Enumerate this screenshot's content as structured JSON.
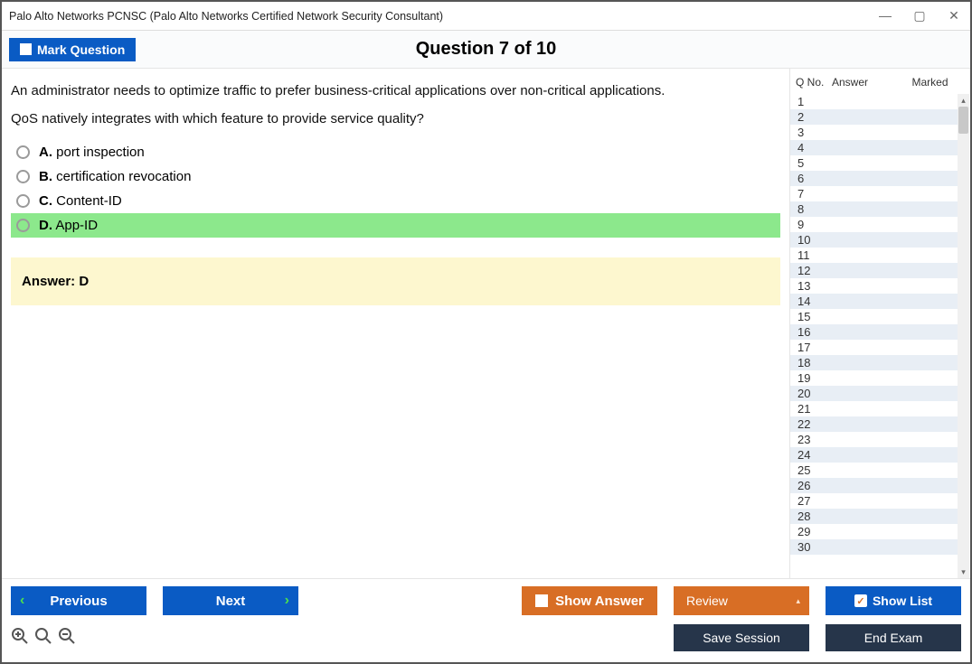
{
  "window_title": "Palo Alto Networks PCNSC (Palo Alto Networks Certified Network Security Consultant)",
  "top": {
    "mark_label": "Mark Question",
    "counter": "Question 7 of 10"
  },
  "question": {
    "line1": "An administrator needs to optimize traffic to prefer business-critical applications over non-critical applications.",
    "line2": "QoS natively integrates with which feature to provide service quality?"
  },
  "options": {
    "A": {
      "letter": "A.",
      "text": "port inspection",
      "correct": false
    },
    "B": {
      "letter": "B.",
      "text": "certification revocation",
      "correct": false
    },
    "C": {
      "letter": "C.",
      "text": "Content-ID",
      "correct": false
    },
    "D": {
      "letter": "D.",
      "text": "App-ID",
      "correct": true
    }
  },
  "answer_box": "Answer: D",
  "sidebar": {
    "headers": {
      "qno": "Q No.",
      "answer": "Answer",
      "marked": "Marked"
    },
    "rows": [
      "1",
      "2",
      "3",
      "4",
      "5",
      "6",
      "7",
      "8",
      "9",
      "10",
      "11",
      "12",
      "13",
      "14",
      "15",
      "16",
      "17",
      "18",
      "19",
      "20",
      "21",
      "22",
      "23",
      "24",
      "25",
      "26",
      "27",
      "28",
      "29",
      "30"
    ]
  },
  "footer": {
    "previous": "Previous",
    "next": "Next",
    "show_answer": "Show Answer",
    "review": "Review",
    "show_list": "Show List",
    "save_session": "Save Session",
    "end_exam": "End Exam"
  }
}
